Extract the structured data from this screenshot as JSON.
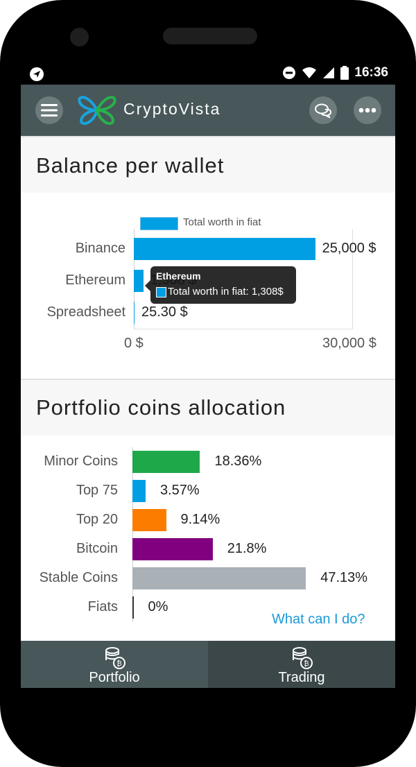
{
  "status_bar": {
    "time": "16:36",
    "icons": [
      "location-arrow-icon",
      "do-not-disturb-icon",
      "wifi-icon",
      "signal-icon",
      "battery-icon"
    ]
  },
  "header": {
    "app_title": "CryptoVista",
    "menu_icon": "hamburger-menu-icon",
    "chat_icon": "chat-bubbles-icon",
    "more_icon": "more-dots-icon"
  },
  "balance_section": {
    "title": "Balance per wallet"
  },
  "portfolio_section": {
    "title": "Portfolio coins allocation"
  },
  "help_link": "What can I do?",
  "bottom_nav": {
    "items": [
      {
        "label": "Portfolio",
        "icon": "coins-stack-icon",
        "active": true
      },
      {
        "label": "Trading",
        "icon": "coins-stack-icon",
        "active": false
      }
    ]
  },
  "colors": {
    "header": "#485759",
    "blue": "#009fe3",
    "green": "#1ea84a",
    "orange": "#fc7c00",
    "purple": "#800080",
    "gray": "#a9b0b6",
    "nav_active": "#485759",
    "nav_inactive": "#3b4749"
  },
  "chart_data": [
    {
      "type": "bar",
      "orientation": "horizontal",
      "title": "Balance per wallet",
      "legend": {
        "label": "Total worth in fiat",
        "placement": "top"
      },
      "categories": [
        "Binance",
        "Ethereum",
        "Spreadsheet"
      ],
      "series": [
        {
          "name": "Total worth in fiat",
          "values": [
            25000,
            1308,
            25.3
          ]
        }
      ],
      "value_labels": [
        "25,000 $",
        "1,308 $",
        "25.30 $"
      ],
      "xlim": [
        0,
        30000
      ],
      "x_ticks": [
        "0 $",
        "30,000 $"
      ],
      "tooltip": {
        "title": "Ethereum",
        "text": "Total worth in fiat: 1,308$"
      }
    },
    {
      "type": "bar",
      "orientation": "horizontal",
      "title": "Portfolio coins allocation",
      "categories": [
        "Minor Coins",
        "Top 75",
        "Top 20",
        "Bitcoin",
        "Stable Coins",
        "Fiats"
      ],
      "values": [
        18.36,
        3.57,
        9.14,
        21.8,
        47.13,
        0
      ],
      "value_labels": [
        "18.36%",
        "3.57%",
        "9.14%",
        "21.8%",
        "47.13%",
        "0%"
      ],
      "bar_colors": [
        "#1ea84a",
        "#009fe3",
        "#fc7c00",
        "#800080",
        "#a9b0b6",
        "#333333"
      ],
      "xlim": [
        0,
        55
      ]
    }
  ]
}
